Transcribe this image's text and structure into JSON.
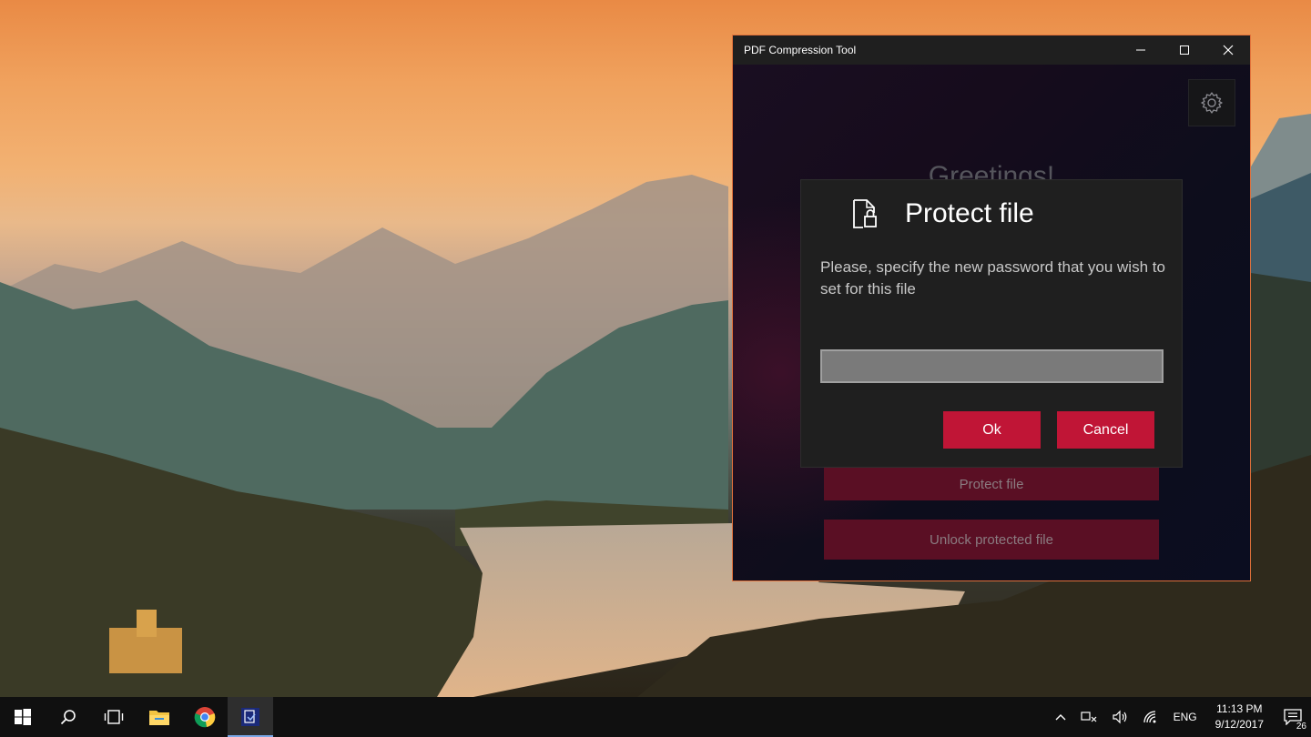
{
  "window": {
    "title": "PDF Compression Tool",
    "greeting": "Greetings!",
    "bg_buttons": [
      "Protect file",
      "Unlock protected file"
    ],
    "border_color": "#e0703a"
  },
  "dialog": {
    "title": "Protect file",
    "message": "Please, specify the new password that you wish to set for this file",
    "password_value": "",
    "ok_label": "Ok",
    "cancel_label": "Cancel",
    "accent": "#c01536"
  },
  "taskbar": {
    "pinned": [
      "start-icon",
      "search-icon",
      "task-view-icon",
      "file-explorer-icon",
      "chrome-icon",
      "pdf-tool-icon"
    ],
    "language": "ENG",
    "time": "11:13 PM",
    "date": "9/12/2017",
    "notification_count": "26"
  }
}
